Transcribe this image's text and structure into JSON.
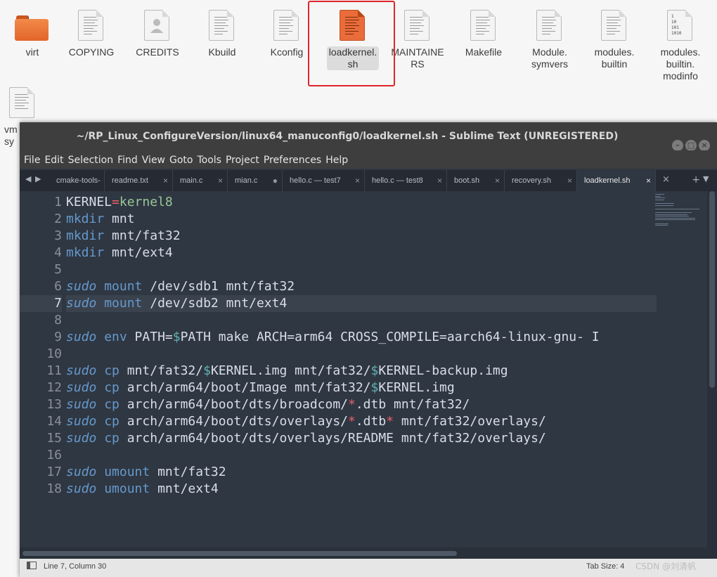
{
  "file_manager": {
    "files": [
      {
        "name": "virt",
        "type": "folder"
      },
      {
        "name": "COPYING",
        "type": "text"
      },
      {
        "name": "CREDITS",
        "type": "contact"
      },
      {
        "name": "Kbuild",
        "type": "text"
      },
      {
        "name": "Kconfig",
        "type": "text"
      },
      {
        "name": "loadkernel.\nsh",
        "type": "script",
        "selected": true
      },
      {
        "name": "MAINTAINE\nRS",
        "type": "text"
      },
      {
        "name": "Makefile",
        "type": "text"
      },
      {
        "name": "Module.\nsymvers",
        "type": "text"
      },
      {
        "name": "modules.\nbuiltin",
        "type": "text"
      },
      {
        "name": "modules.\nbuiltin.\nmodinfo",
        "type": "binary"
      }
    ],
    "partial_label": "vm\nsy",
    "binary_glyph": "1\n10\n101\n1010"
  },
  "window": {
    "title": "~/RP_Linux_ConfigureVersion/linux64_manuconfig0/loadkernel.sh - Sublime Text (UNREGISTERED)",
    "buttons": {
      "minimize": "–",
      "maximize": "□",
      "close": "×"
    }
  },
  "menu": [
    "File",
    "Edit",
    "Selection",
    "Find",
    "View",
    "Goto",
    "Tools",
    "Project",
    "Preferences",
    "Help"
  ],
  "tabs": [
    {
      "label": "cmake-tools-",
      "close": ""
    },
    {
      "label": "readme.txt",
      "close": "×"
    },
    {
      "label": "main.c",
      "close": "×"
    },
    {
      "label": "mian.c",
      "close": "●"
    },
    {
      "label": "hello.c — test7",
      "close": "×"
    },
    {
      "label": "hello.c — test8",
      "close": "×"
    },
    {
      "label": "boot.sh",
      "close": "×"
    },
    {
      "label": "recovery.sh",
      "close": "×"
    },
    {
      "label": "loadkernel.sh",
      "close": "×",
      "active": true
    }
  ],
  "tab_controls": {
    "left": "◀",
    "right": "▶",
    "extra_close": "×",
    "plus": "+",
    "menu": "▼"
  },
  "editor": {
    "current_line": 7,
    "lines": [
      [
        [
          "v",
          "KERNEL"
        ],
        [
          "o",
          "="
        ],
        [
          "s",
          "kernel8"
        ]
      ],
      [
        [
          "c",
          "mkdir"
        ],
        [
          "t",
          " mnt"
        ]
      ],
      [
        [
          "c",
          "mkdir"
        ],
        [
          "t",
          " mnt/fat32"
        ]
      ],
      [
        [
          "c",
          "mkdir"
        ],
        [
          "t",
          " mnt/ext4"
        ]
      ],
      [],
      [
        [
          "u",
          "sudo"
        ],
        [
          "t",
          " "
        ],
        [
          "c",
          "mount"
        ],
        [
          "t",
          " /dev/sdb1 mnt/fat32"
        ]
      ],
      [
        [
          "u",
          "sudo"
        ],
        [
          "t",
          " "
        ],
        [
          "c",
          "mount"
        ],
        [
          "t",
          " /dev/sdb2 mnt/ext4"
        ]
      ],
      [],
      [
        [
          "u",
          "sudo"
        ],
        [
          "t",
          " "
        ],
        [
          "c",
          "env"
        ],
        [
          "t",
          " PATH="
        ],
        [
          "d",
          "$"
        ],
        [
          "t",
          "PATH make ARCH=arm64 CROSS_COMPILE=aarch64-linux-gnu- I"
        ]
      ],
      [],
      [
        [
          "u",
          "sudo"
        ],
        [
          "t",
          " "
        ],
        [
          "c",
          "cp"
        ],
        [
          "t",
          " mnt/fat32/"
        ],
        [
          "d",
          "$"
        ],
        [
          "t",
          "KERNEL.img mnt/fat32/"
        ],
        [
          "d",
          "$"
        ],
        [
          "t",
          "KERNEL-backup.img"
        ]
      ],
      [
        [
          "u",
          "sudo"
        ],
        [
          "t",
          " "
        ],
        [
          "c",
          "cp"
        ],
        [
          "t",
          " arch/arm64/boot/Image mnt/fat32/"
        ],
        [
          "d",
          "$"
        ],
        [
          "t",
          "KERNEL.img"
        ]
      ],
      [
        [
          "u",
          "sudo"
        ],
        [
          "t",
          " "
        ],
        [
          "c",
          "cp"
        ],
        [
          "t",
          " arch/arm64/boot/dts/broadcom/"
        ],
        [
          "x",
          "*"
        ],
        [
          "t",
          ".dtb mnt/fat32/"
        ]
      ],
      [
        [
          "u",
          "sudo"
        ],
        [
          "t",
          " "
        ],
        [
          "c",
          "cp"
        ],
        [
          "t",
          " arch/arm64/boot/dts/overlays/"
        ],
        [
          "x",
          "*"
        ],
        [
          "t",
          ".dtb"
        ],
        [
          "x",
          "*"
        ],
        [
          "t",
          " mnt/fat32/overlays/"
        ]
      ],
      [
        [
          "u",
          "sudo"
        ],
        [
          "t",
          " "
        ],
        [
          "c",
          "cp"
        ],
        [
          "t",
          " arch/arm64/boot/dts/overlays/README mnt/fat32/overlays/"
        ]
      ],
      [],
      [
        [
          "u",
          "sudo"
        ],
        [
          "t",
          " "
        ],
        [
          "c",
          "umount"
        ],
        [
          "t",
          " mnt/fat32"
        ]
      ],
      [
        [
          "u",
          "sudo"
        ],
        [
          "t",
          " "
        ],
        [
          "c",
          "umount"
        ],
        [
          "t",
          " mnt/ext4"
        ]
      ]
    ]
  },
  "status": {
    "position": "Line 7, Column 30",
    "tab_size": "Tab Size: 4"
  },
  "watermark": "CSDN @刘清帆",
  "colors": {
    "accent_highlight": "#e0252b",
    "editor_bg": "#2f3742",
    "keyword_blue": "#6699cc",
    "string_green": "#99c794",
    "operator_red": "#ec5f67",
    "dollar_teal": "#5fb3b3"
  }
}
